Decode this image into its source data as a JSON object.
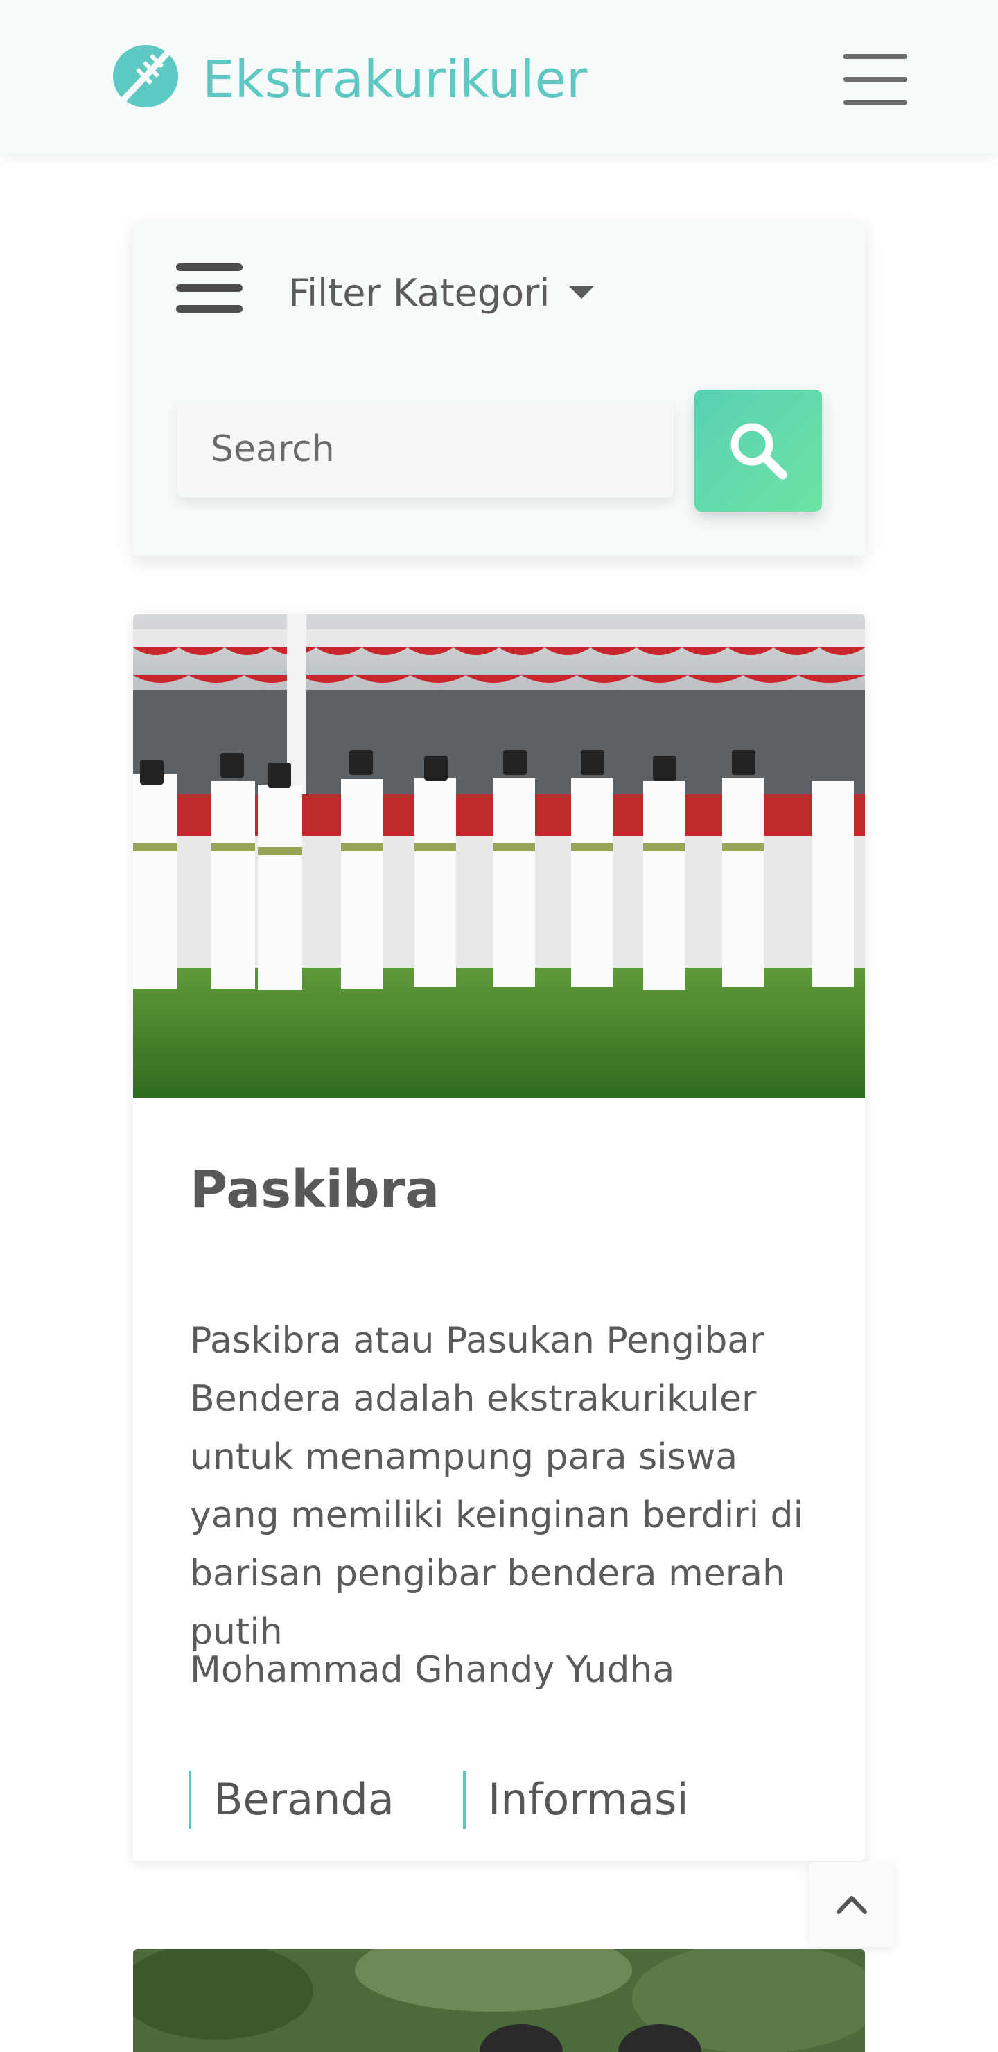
{
  "navbar": {
    "brand_icon": "football-icon",
    "brand_name": "Ekstrakurikuler",
    "menu_icon": "hamburger-menu-icon"
  },
  "filter": {
    "list_icon": "filter-list-icon",
    "dropdown_label": "Filter Kategori",
    "search_placeholder": "Search",
    "search_value": "",
    "search_icon": "search-icon"
  },
  "cards": [
    {
      "image": "paskibra-flag-team-photo",
      "title": "Paskibra",
      "description": "Paskibra atau Pasukan Pengibar Bendera adalah ekstrakurikuler untuk menampung para siswa yang memiliki keinginan berdiri di barisan pengibar bendera merah putih",
      "author": "Mohammad Ghandy Yudha",
      "links": [
        "Beranda",
        "Informasi"
      ]
    }
  ],
  "back_to_top_icon": "chevron-up-icon",
  "colors": {
    "accent": "#5ec9c3",
    "search_button_gradient_start": "#57d0b4",
    "search_button_gradient_end": "#6ee3a3",
    "navbar_bg": "#f6fafa",
    "text": "#5b5b5b"
  }
}
